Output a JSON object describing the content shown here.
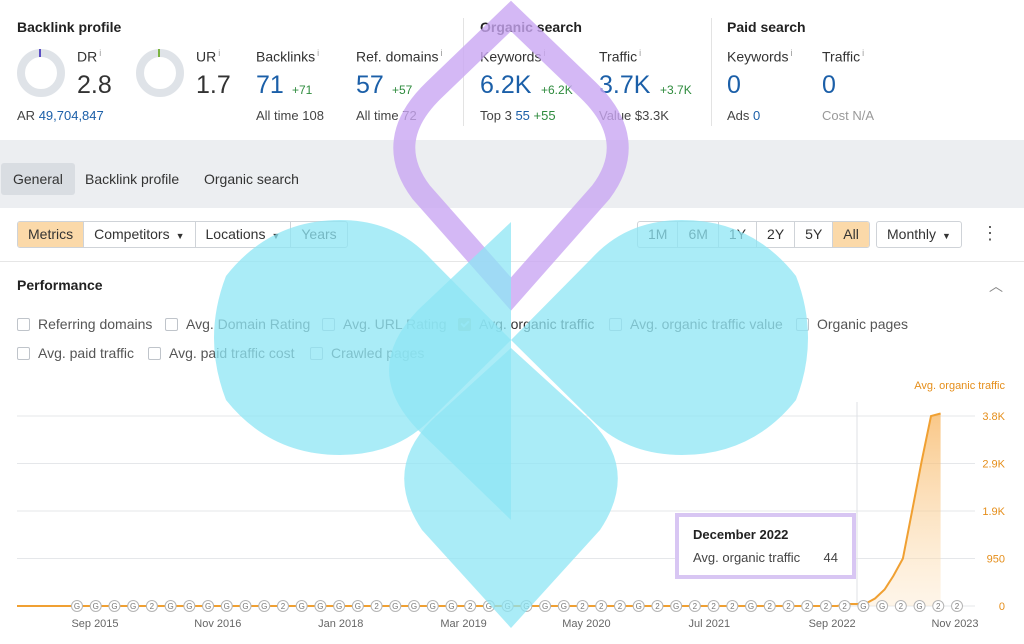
{
  "backlink": {
    "title": "Backlink profile",
    "dr": {
      "label": "DR",
      "value": "2.8"
    },
    "ur": {
      "label": "UR",
      "value": "1.7"
    },
    "ar_label": "AR",
    "ar_value": "49,704,847",
    "backlinks": {
      "label": "Backlinks",
      "value": "71",
      "delta": "+71",
      "sub_label": "All time",
      "sub_value": "108"
    },
    "ref_domains": {
      "label": "Ref. domains",
      "value": "57",
      "delta": "+57",
      "sub_label": "All time",
      "sub_value": "72"
    },
    "info_mark": "i"
  },
  "organic": {
    "title": "Organic search",
    "keywords": {
      "label": "Keywords",
      "value": "6.2K",
      "delta": "+6.2K",
      "sub_label": "Top 3",
      "sub_value": "55",
      "sub_delta": "+55"
    },
    "traffic": {
      "label": "Traffic",
      "value": "3.7K",
      "delta": "+3.7K",
      "sub_label": "Value",
      "sub_value": "$3.3K"
    }
  },
  "paid": {
    "title": "Paid search",
    "keywords": {
      "label": "Keywords",
      "value": "0",
      "sub_label": "Ads",
      "sub_value": "0"
    },
    "traffic": {
      "label": "Traffic",
      "value": "0",
      "sub_label": "Cost",
      "sub_value": "N/A"
    }
  },
  "tabs": [
    "General",
    "Backlink profile",
    "Organic search"
  ],
  "toolbar": {
    "metrics": "Metrics",
    "competitors": "Competitors",
    "locations": "Locations",
    "years": "Years",
    "ranges": [
      "1M",
      "6M",
      "1Y",
      "2Y",
      "5Y",
      "All"
    ],
    "active_range": "All",
    "interval": "Monthly",
    "caret": "▼",
    "kebab": "⋮"
  },
  "performance": {
    "title": "Performance",
    "collapse_icon": "︿",
    "checkboxes": [
      {
        "label": "Referring domains",
        "checked": false
      },
      {
        "label": "Avg. Domain Rating",
        "checked": false
      },
      {
        "label": "Avg. URL Rating",
        "checked": false
      },
      {
        "label": "Avg. organic traffic",
        "checked": true
      },
      {
        "label": "Avg. organic traffic value",
        "checked": false
      },
      {
        "label": "Organic pages",
        "checked": false
      },
      {
        "label": "Avg. paid traffic",
        "checked": false
      },
      {
        "label": "Avg. paid traffic cost",
        "checked": false
      },
      {
        "label": "Crawled pages",
        "checked": false
      }
    ]
  },
  "chart_data": {
    "type": "area",
    "series": [
      {
        "name": "Avg. organic traffic",
        "color": "#f0a032",
        "values": [
          {
            "date": "2015-06",
            "y": 0
          },
          {
            "date": "2022-09",
            "y": 0
          },
          {
            "date": "2022-10",
            "y": 40
          },
          {
            "date": "2022-11",
            "y": 40
          },
          {
            "date": "2022-12",
            "y": 44
          },
          {
            "date": "2023-01",
            "y": 150
          },
          {
            "date": "2023-02",
            "y": 330
          },
          {
            "date": "2023-03",
            "y": 600
          },
          {
            "date": "2023-04",
            "y": 950
          },
          {
            "date": "2023-05",
            "y": 1900
          },
          {
            "date": "2023-06",
            "y": 2900
          },
          {
            "date": "2023-07",
            "y": 3800
          },
          {
            "date": "2023-08",
            "y": 3850
          }
        ]
      }
    ],
    "x_ticks": [
      "Sep 2015",
      "Nov 2016",
      "Jan 2018",
      "Mar 2019",
      "May 2020",
      "Jul 2021",
      "Sep 2022",
      "Nov 2023"
    ],
    "y_ticks": [
      "0",
      "950",
      "1.9K",
      "2.9K",
      "3.8K"
    ],
    "y_range": [
      0,
      3800
    ],
    "grid": true,
    "legend": "top-right",
    "event_labels": [
      "G",
      "G",
      "G",
      "G",
      "2",
      "G",
      "G",
      "G",
      "G",
      "G",
      "G",
      "2",
      "G",
      "G",
      "G",
      "G",
      "2",
      "G",
      "G",
      "G",
      "G",
      "2",
      "G",
      "G",
      "G",
      "G",
      "G",
      "2",
      "2",
      "2",
      "G",
      "2",
      "G",
      "2",
      "2",
      "2",
      "G",
      "2",
      "2",
      "2",
      "2",
      "2",
      "G",
      "G",
      "2",
      "G",
      "2",
      "2"
    ]
  },
  "tooltip": {
    "title": "December 2022",
    "label": "Avg. organic traffic",
    "value": "44"
  }
}
